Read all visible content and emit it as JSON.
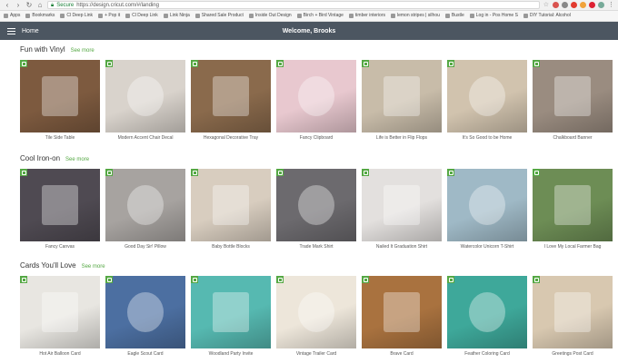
{
  "browser": {
    "secure_label": "Secure",
    "url": "https://design.cricut.com/#/landing",
    "bookmarks": [
      "Apps",
      "Bookmarks",
      "Cl Deep Link",
      "+ Pop it",
      "Cl Deep Link",
      "Link Ninja",
      "Shared Sale Product",
      "Inside Out Design",
      "Birch + Bird Vintage",
      "timber interiors",
      "lemon stripes | silhou",
      "Bustle",
      "Log in - Pos Home S",
      "DIY Tutorial: Alcohol"
    ]
  },
  "header": {
    "home_label": "Home",
    "welcome": "Welcome, Brooks"
  },
  "sections": [
    {
      "title": "Fun with Vinyl",
      "see_more": "See more",
      "cards": [
        "Tile Side Table",
        "Modern Accent Chair Decal",
        "Hexagonal Decorative Tray",
        "Fancy Clipboard",
        "Life is Better in Flip Flops",
        "It's So Good to be Home",
        "Chalkboard Banner"
      ]
    },
    {
      "title": "Cool Iron-on",
      "see_more": "See more",
      "cards": [
        "Fancy Canvas",
        "Good Day Sir! Pillow",
        "Baby Bottle Blocks",
        "Trade Mark Shirt",
        "Nailed It Graduation Shirt",
        "Watercolor Unicorn T-Shirt",
        "I Love My Local Farmer Bag"
      ]
    },
    {
      "title": "Cards You'll Love",
      "see_more": "See more",
      "cards": [
        "Hot Air Balloon Card",
        "Eagle Scout Card",
        "Woodland Party Invite",
        "Vintage Trailer Card",
        "Brave Card",
        "Feather Coloring Card",
        "Greetings Post Card"
      ]
    }
  ],
  "thumb_colors": [
    [
      "#7d5a3f",
      "#d9d3cc",
      "#8a6a4c",
      "#e8c8cf",
      "#c8bca9",
      "#d1c3ae",
      "#9a8c80"
    ],
    [
      "#4f4a52",
      "#a7a3a0",
      "#d8cdbf",
      "#6c6a6e",
      "#e3e0de",
      "#9fb9c6",
      "#6d8d55"
    ],
    [
      "#e8e6e1",
      "#4c6fa1",
      "#56b9b1",
      "#ede6da",
      "#a9723f",
      "#3ea89a",
      "#d8c8b0"
    ]
  ],
  "colors": {
    "header_bg": "#4c5661",
    "accent": "#55a844"
  }
}
